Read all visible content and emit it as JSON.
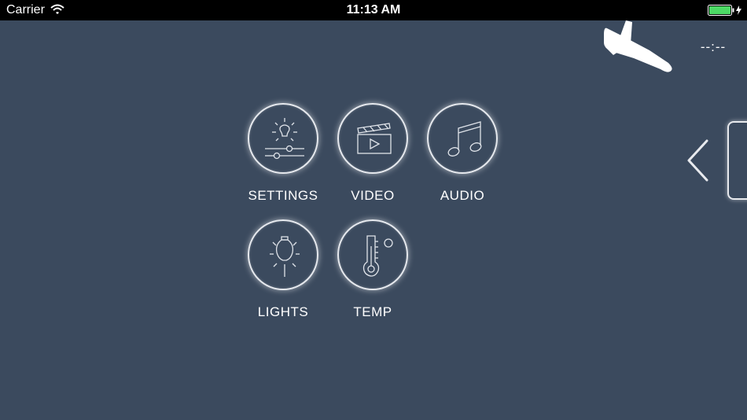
{
  "status_bar": {
    "carrier": "Carrier",
    "time": "11:13 AM",
    "wifi_icon": "wifi-icon",
    "battery_icon": "battery-charging-icon",
    "battery_color": "#4cd964"
  },
  "header": {
    "flight_icon": "airplane-landing-icon",
    "time_readout": "--:--"
  },
  "menu": {
    "items": [
      {
        "label": "SETTINGS",
        "icon": "settings-sliders-icon"
      },
      {
        "label": "VIDEO",
        "icon": "clapperboard-icon"
      },
      {
        "label": "AUDIO",
        "icon": "music-note-icon"
      },
      {
        "label": "LIGHTS",
        "icon": "lightbulb-icon"
      },
      {
        "label": "TEMP",
        "icon": "thermometer-icon"
      }
    ]
  },
  "side_panel": {
    "chevron_icon": "chevron-left-icon"
  },
  "colors": {
    "background": "#3b4a5e",
    "accent": "#ffffff"
  }
}
